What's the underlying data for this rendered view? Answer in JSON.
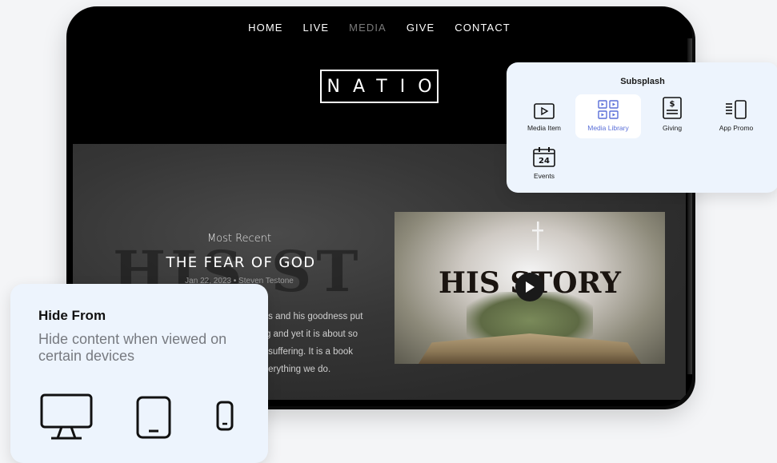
{
  "nav": {
    "items": [
      "HOME",
      "LIVE",
      "MEDIA",
      "GIVE",
      "CONTACT"
    ],
    "active": "MEDIA"
  },
  "logo": {
    "text": "NATIO"
  },
  "hero": {
    "background_text": "HIS ST",
    "eyebrow": "Most Recent",
    "title": "THE FEAR OF GOD",
    "meta": "Jan 22, 2023 • Steven Testone",
    "description_lines": [
      "ess and his goodness put",
      "ing and yet it is about so",
      "in suffering. It is a book",
      "everything we do."
    ]
  },
  "video": {
    "title": "HIS STORY",
    "play_icon": "play-icon"
  },
  "subsplash": {
    "title": "Subsplash",
    "items": [
      {
        "label": "Media Item",
        "icon": "media-item-icon"
      },
      {
        "label": "Media Library",
        "icon": "media-library-icon",
        "selected": true
      },
      {
        "label": "Giving",
        "icon": "giving-icon"
      },
      {
        "label": "App Promo",
        "icon": "app-promo-icon"
      },
      {
        "label": "Events",
        "icon": "events-icon",
        "icon_text": "24"
      }
    ],
    "accent": "#5a6fd8"
  },
  "hide_from": {
    "title": "Hide From",
    "description": "Hide content when viewed on certain devices",
    "devices": [
      "desktop-icon",
      "tablet-icon",
      "phone-icon"
    ]
  }
}
